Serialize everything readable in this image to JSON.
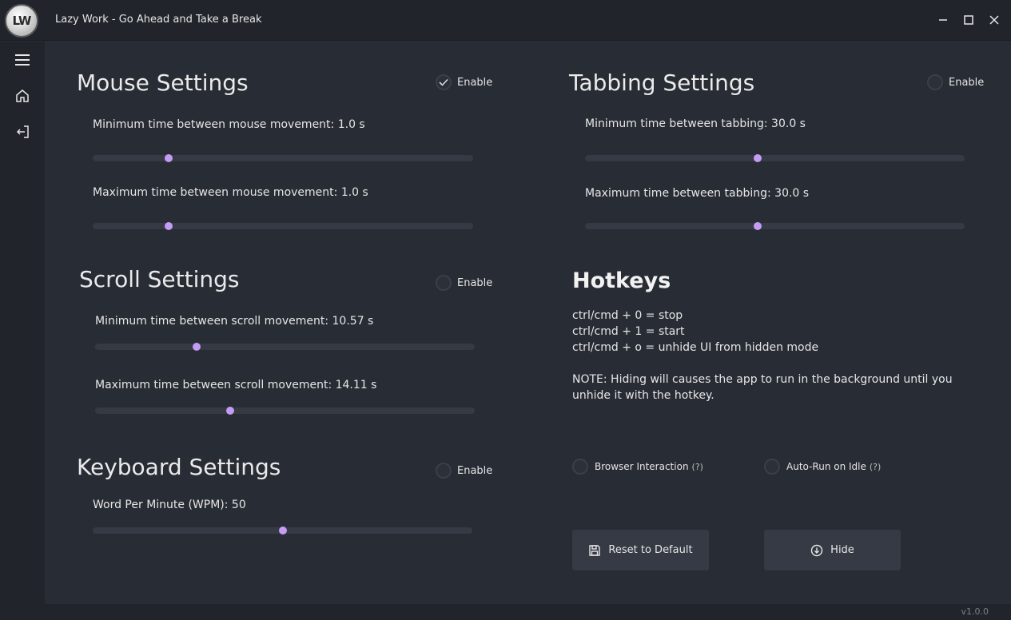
{
  "window": {
    "logo_text": "LW",
    "title": "Lazy Work - Go Ahead and Take a Break"
  },
  "sidebar": {
    "items": [
      {
        "icon": "hamburger-icon"
      },
      {
        "icon": "home-icon"
      },
      {
        "icon": "logout-icon"
      }
    ]
  },
  "mouse": {
    "title": "Mouse Settings",
    "enable_label": "Enable",
    "enabled": true,
    "min_label": "Minimum time between mouse movement: 1.0 s",
    "min_fraction": 0.2,
    "max_label": "Maximum time between mouse movement: 1.0 s",
    "max_fraction": 0.2
  },
  "tabbing": {
    "title": "Tabbing Settings",
    "enable_label": "Enable",
    "enabled": false,
    "min_label": "Minimum time between tabbing: 30.0 s",
    "min_fraction": 0.455,
    "max_label": "Maximum time between tabbing: 30.0 s",
    "max_fraction": 0.455
  },
  "scroll": {
    "title": "Scroll Settings",
    "enable_label": "Enable",
    "enabled": false,
    "min_label": "Minimum time between scroll movement: 10.57 s",
    "min_fraction": 0.267,
    "max_label": "Maximum time between scroll movement: 14.11 s",
    "max_fraction": 0.356
  },
  "keyboard": {
    "title": "Keyboard Settings",
    "enable_label": "Enable",
    "enabled": false,
    "wpm_label": "Word Per Minute (WPM): 50",
    "wpm_fraction": 0.5
  },
  "hotkeys": {
    "title": "Hotkeys",
    "lines": [
      "ctrl/cmd + 0 = stop",
      "ctrl/cmd + 1 = start",
      "ctrl/cmd + o = unhide UI from hidden mode"
    ],
    "note_line1": "NOTE: Hiding will causes the app to run in the background until you",
    "note_line2": "unhide it with the hotkey."
  },
  "options": {
    "browser_interaction": "Browser Interaction",
    "auto_run": "Auto-Run on Idle",
    "help_mark": "(?)"
  },
  "buttons": {
    "reset": "Reset to Default",
    "hide": "Hide"
  },
  "footer": {
    "version": "v1.0.0"
  },
  "colors": {
    "accent": "#c59cf4",
    "background": "#282c34",
    "panel": "#21252b",
    "track": "#353a44"
  }
}
